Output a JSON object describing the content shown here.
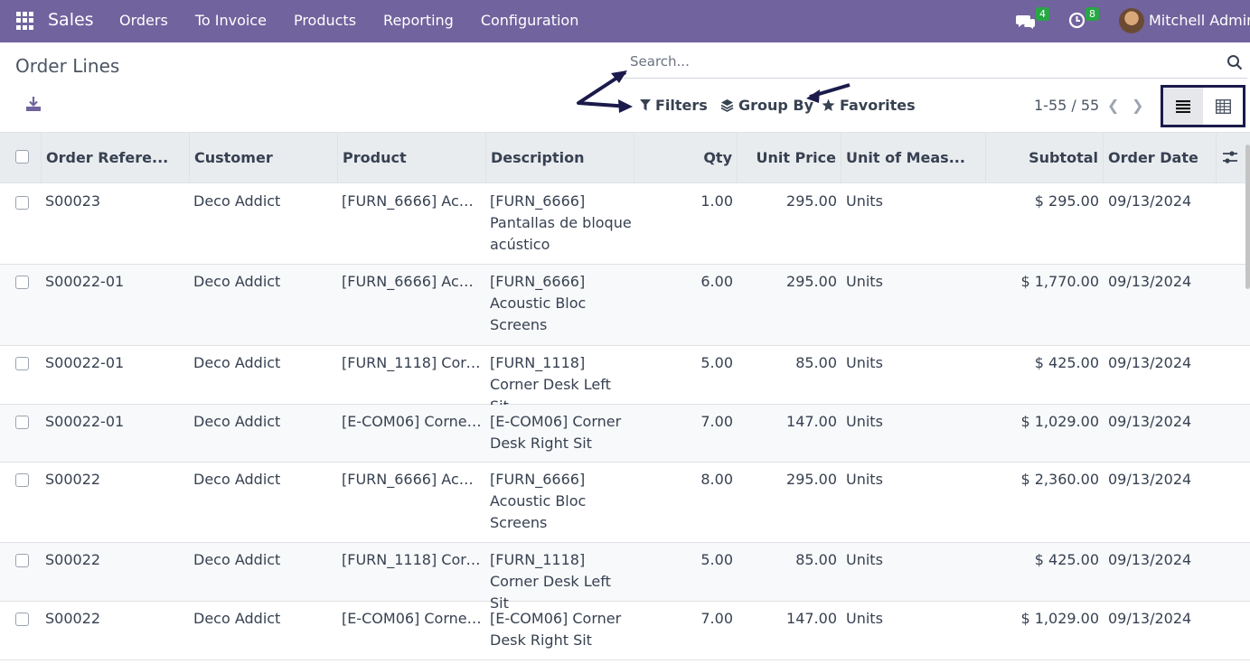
{
  "navbar": {
    "brand": "Sales",
    "menu": [
      "Orders",
      "To Invoice",
      "Products",
      "Reporting",
      "Configuration"
    ],
    "messages_count": "4",
    "activities_count": "8",
    "user_name": "Mitchell Admin"
  },
  "control_panel": {
    "title": "Order Lines",
    "search_placeholder": "Search...",
    "filters_label": "Filters",
    "group_by_label": "Group By",
    "favorites_label": "Favorites",
    "pager": "1-55 / 55",
    "active_view": "list"
  },
  "table": {
    "columns": [
      "Order Refere...",
      "Customer",
      "Product",
      "Description",
      "Qty",
      "Unit Price",
      "Unit of Meas...",
      "Subtotal",
      "Order Date"
    ],
    "rows": [
      {
        "ref": "S00023",
        "customer": "Deco Addict",
        "product": "[FURN_6666] Acou...",
        "description": "[FURN_6666] Pantallas de bloque acústico",
        "qty": "1.00",
        "unit_price": "295.00",
        "uom": "Units",
        "subtotal": "$ 295.00",
        "date": "09/13/2024"
      },
      {
        "ref": "S00022-01",
        "customer": "Deco Addict",
        "product": "[FURN_6666] Acou...",
        "description": "[FURN_6666] Acoustic Bloc Screens",
        "qty": "6.00",
        "unit_price": "295.00",
        "uom": "Units",
        "subtotal": "$ 1,770.00",
        "date": "09/13/2024"
      },
      {
        "ref": "S00022-01",
        "customer": "Deco Addict",
        "product": "[FURN_1118] Corn...",
        "description": "[FURN_1118] Corner Desk Left Sit",
        "qty": "5.00",
        "unit_price": "85.00",
        "uom": "Units",
        "subtotal": "$ 425.00",
        "date": "09/13/2024"
      },
      {
        "ref": "S00022-01",
        "customer": "Deco Addict",
        "product": "[E-COM06] Corner ...",
        "description": "[E-COM06] Corner Desk Right Sit",
        "qty": "7.00",
        "unit_price": "147.00",
        "uom": "Units",
        "subtotal": "$ 1,029.00",
        "date": "09/13/2024"
      },
      {
        "ref": "S00022",
        "customer": "Deco Addict",
        "product": "[FURN_6666] Acou...",
        "description": "[FURN_6666] Acoustic Bloc Screens",
        "qty": "8.00",
        "unit_price": "295.00",
        "uom": "Units",
        "subtotal": "$ 2,360.00",
        "date": "09/13/2024"
      },
      {
        "ref": "S00022",
        "customer": "Deco Addict",
        "product": "[FURN_1118] Corn...",
        "description": "[FURN_1118] Corner Desk Left Sit",
        "qty": "5.00",
        "unit_price": "85.00",
        "uom": "Units",
        "subtotal": "$ 425.00",
        "date": "09/13/2024"
      },
      {
        "ref": "S00022",
        "customer": "Deco Addict",
        "product": "[E-COM06] Corner ...",
        "description": "[E-COM06] Corner Desk Right Sit",
        "qty": "7.00",
        "unit_price": "147.00",
        "uom": "Units",
        "subtotal": "$ 1,029.00",
        "date": "09/13/2024"
      }
    ]
  },
  "colors": {
    "navbar": "#71639e",
    "annotation": "#1b1a4b",
    "badge": "#28a745"
  }
}
